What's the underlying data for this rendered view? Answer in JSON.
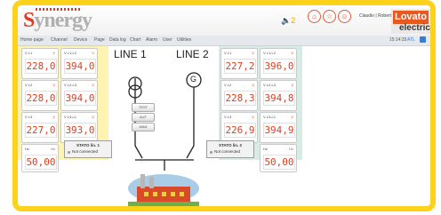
{
  "header": {
    "logo": "Synergy",
    "user": "Claudio | Roberto",
    "brand_top": "Lovato",
    "brand_bottom": "electric",
    "speaker_badge": "2"
  },
  "menu": {
    "items": [
      "Home page",
      "Channel",
      "Device",
      "Page",
      "Data log",
      "Chart",
      "Alarm",
      "User",
      "Utilities"
    ],
    "time": "15:14:33",
    "location": "ATL"
  },
  "lines": {
    "line1": "LINE 1",
    "line2": "LINE 2",
    "generator_symbol": "G"
  },
  "buttons": {
    "test": "TEST",
    "aut": "AUT",
    "man": "MAN"
  },
  "left_cards": [
    {
      "label": "V L1",
      "unit": "V",
      "value": "228,0"
    },
    {
      "label": "V L1-L2",
      "unit": "V",
      "value": "394,0"
    },
    {
      "label": "V L2",
      "unit": "V",
      "value": "228,0"
    },
    {
      "label": "V L2-L3",
      "unit": "V",
      "value": "394,0"
    },
    {
      "label": "V L3",
      "unit": "V",
      "value": "227,0"
    },
    {
      "label": "V L3-L1",
      "unit": "V",
      "value": "393,0"
    },
    {
      "label": "Hz",
      "unit": "Hz",
      "value": "50,00"
    }
  ],
  "right_cards": [
    {
      "label": "V L1",
      "unit": "V",
      "value": "227,2"
    },
    {
      "label": "V L1-L2",
      "unit": "V",
      "value": "396,0"
    },
    {
      "label": "V L2",
      "unit": "V",
      "value": "228,3"
    },
    {
      "label": "V L2-L3",
      "unit": "V",
      "value": "394,8"
    },
    {
      "label": "V L3",
      "unit": "V",
      "value": "226,9"
    },
    {
      "label": "V L3-L1",
      "unit": "V",
      "value": "394,9"
    },
    {
      "label": "Hz",
      "unit": "Hz",
      "value": "50,00"
    }
  ],
  "status1": {
    "title": "STATO lin. 1",
    "text": "Not connected"
  },
  "status2": {
    "title": "STATO lin. 2",
    "text": "Not connected"
  },
  "colors": {
    "frame": "#fdd21a",
    "accent": "#e0401f",
    "left_panel": "#fff3b2",
    "right_panel": "#d7ece7",
    "brand": "#e8591f"
  }
}
